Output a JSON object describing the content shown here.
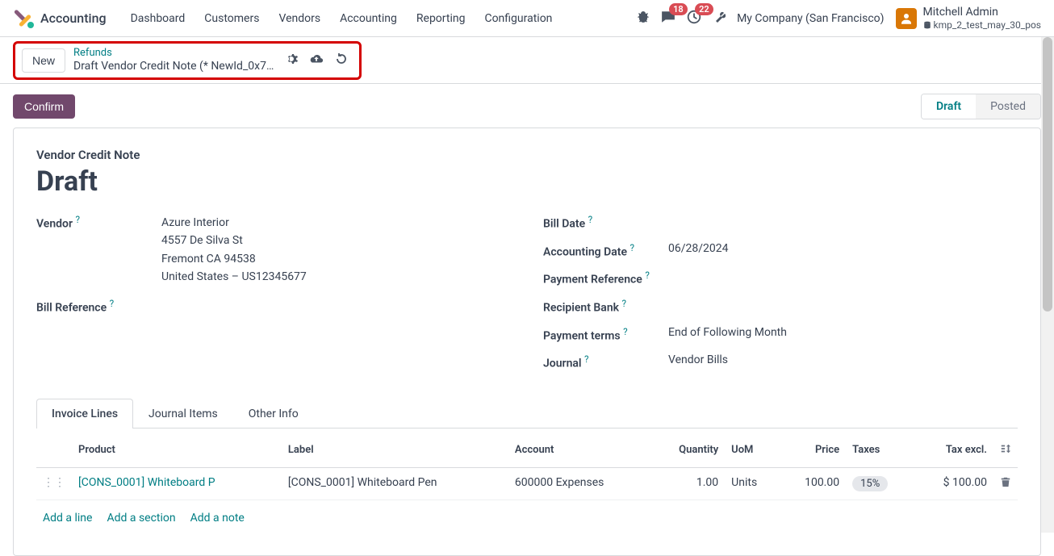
{
  "nav": {
    "app": "Accounting",
    "links": [
      "Dashboard",
      "Customers",
      "Vendors",
      "Accounting",
      "Reporting",
      "Configuration"
    ],
    "messages_badge": "18",
    "activities_badge": "22",
    "company": "My Company (San Francisco)",
    "user_name": "Mitchell Admin",
    "db_name": "kmp_2_test_may_30_pos"
  },
  "breadcrumb": {
    "new_label": "New",
    "parent": "Refunds",
    "current": "Draft Vendor Credit Note (* NewId_0x7…"
  },
  "actions": {
    "confirm": "Confirm"
  },
  "status": {
    "draft": "Draft",
    "posted": "Posted"
  },
  "doc": {
    "type": "Vendor Credit Note",
    "title": "Draft"
  },
  "left": {
    "vendor_label": "Vendor",
    "vendor_name": "Azure Interior",
    "vendor_street": "4557 De Silva St",
    "vendor_city": "Fremont CA 94538",
    "vendor_country": "United States – US12345677",
    "bill_ref_label": "Bill Reference"
  },
  "right": {
    "bill_date_label": "Bill Date",
    "acct_date_label": "Accounting Date",
    "acct_date": "06/28/2024",
    "pay_ref_label": "Payment Reference",
    "bank_label": "Recipient Bank",
    "terms_label": "Payment terms",
    "terms": "End of Following Month",
    "journal_label": "Journal",
    "journal": "Vendor Bills"
  },
  "tabs": {
    "invoice": "Invoice Lines",
    "journal": "Journal Items",
    "other": "Other Info"
  },
  "table": {
    "h_product": "Product",
    "h_label": "Label",
    "h_account": "Account",
    "h_qty": "Quantity",
    "h_uom": "UoM",
    "h_price": "Price",
    "h_taxes": "Taxes",
    "h_taxexcl": "Tax excl.",
    "row": {
      "product": "[CONS_0001] Whiteboard P",
      "label": "[CONS_0001] Whiteboard Pen",
      "account": "600000 Expenses",
      "qty": "1.00",
      "uom": "Units",
      "price": "100.00",
      "tax": "15%",
      "taxexcl": "$ 100.00"
    },
    "add_line": "Add a line",
    "add_section": "Add a section",
    "add_note": "Add a note"
  }
}
